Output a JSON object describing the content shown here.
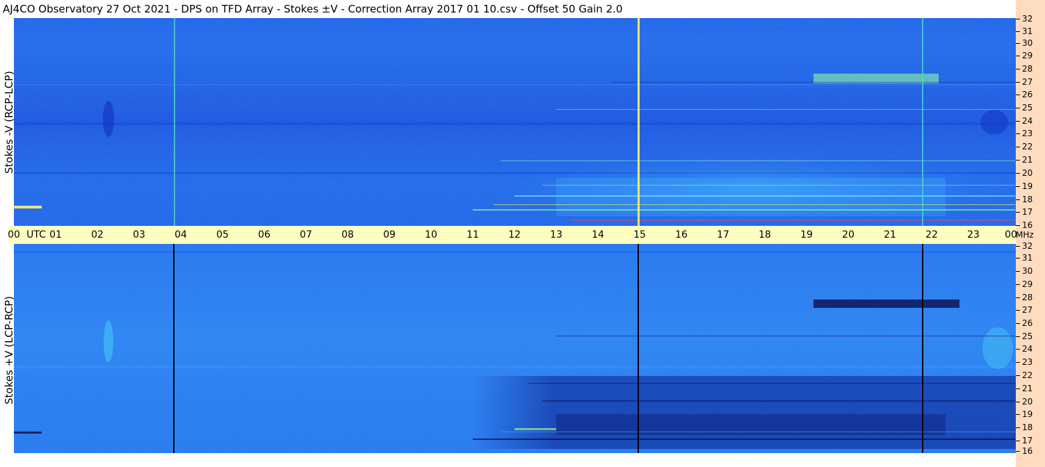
{
  "window": {
    "title": "AJ4CO Observatory  27 Oct 2021  -  DPS on TFD Array  -  Stokes ±V  -  Correction Array 2017 01 10.csv  -  Offset 50  Gain 2.0"
  },
  "panels": {
    "top": {
      "label": "Stokes -V (RCP-LCP)"
    },
    "bottom": {
      "label": "Stokes +V (LCP-RCP)"
    }
  },
  "time_axis": {
    "labels": [
      "00",
      "01",
      "02",
      "03",
      "04",
      "05",
      "06",
      "07",
      "08",
      "09",
      "10",
      "11",
      "12",
      "13",
      "14",
      "15",
      "16",
      "17",
      "18",
      "19",
      "20",
      "21",
      "22",
      "23",
      "00"
    ],
    "unit_label": "UTC"
  },
  "frequency_axis": {
    "labels": [
      "32",
      "31",
      "30",
      "29",
      "28",
      "27",
      "26",
      "25",
      "24",
      "23",
      "22",
      "21",
      "20",
      "19",
      "18",
      "17",
      "16"
    ],
    "unit_label": "MHz"
  },
  "colors": {
    "background": "#ffffff",
    "utc_bar": "#ffffc0",
    "right_strip": "#ffdcc0",
    "spectrogram_base": "#1f57e6"
  }
}
